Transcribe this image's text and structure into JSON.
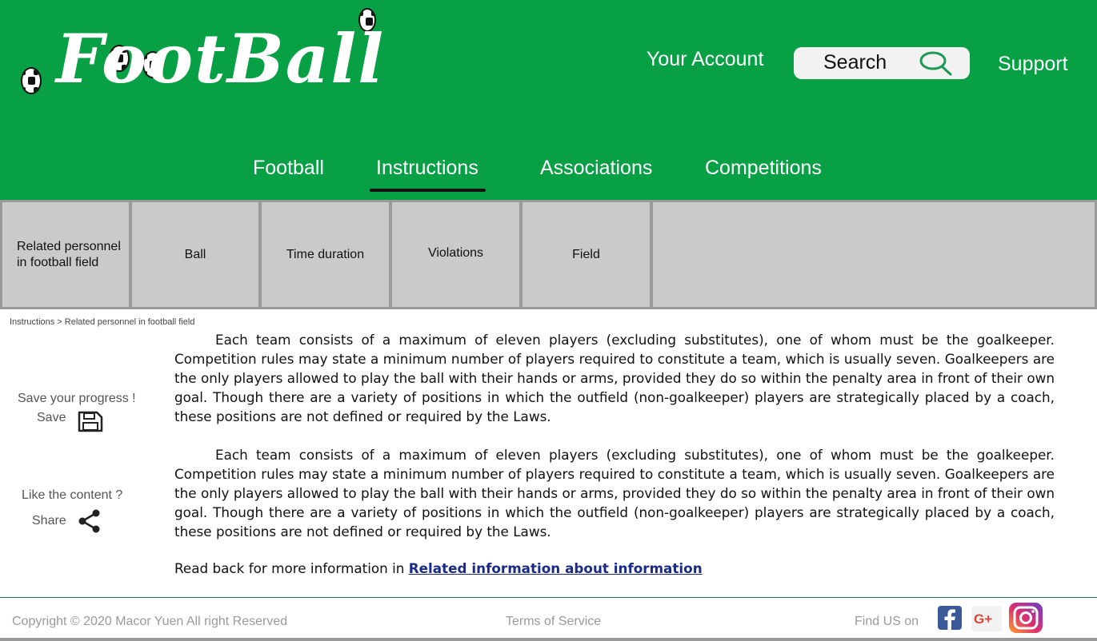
{
  "header": {
    "logo_text": "FootBall",
    "account_label": "Your Account",
    "search_label": "Search",
    "support_label": "Support"
  },
  "nav": {
    "tabs": [
      {
        "label": "Football"
      },
      {
        "label": "Instructions",
        "active": true
      },
      {
        "label": "Associations"
      },
      {
        "label": "Competitions"
      }
    ]
  },
  "subtabs": [
    {
      "label": "Related personnel in football field"
    },
    {
      "label": "Ball"
    },
    {
      "label": "Time duration"
    },
    {
      "label": "Violations"
    },
    {
      "label": "Field"
    }
  ],
  "breadcrumb": "Instructions > Related personnel in football field",
  "sidebar": {
    "save_prompt": "Save your progress !",
    "save_label": "Save",
    "share_prompt": "Like the content ?",
    "share_label": "Share"
  },
  "content": {
    "paragraphs": [
      "Each team consists of a maximum of eleven players (excluding substitutes), one of whom must be the goalkeeper. Competition rules may state a minimum number of players required to constitute a team, which is usually seven. Goalkeepers are the only players allowed to play the ball with their hands or arms, provided they do so within the penalty area in front of their own goal. Though there are a variety of positions in which the outfield (non-goalkeeper) players are strategically placed by a coach, these positions are not defined or required by the Laws.",
      "Each team consists of a maximum of eleven players (excluding substitutes), one of whom must be the goalkeeper. Competition rules may state a minimum number of players required to constitute a team, which is usually seven. Goalkeepers are the only players allowed to play the ball with their hands or arms, provided they do so within the penalty area in front of their own goal. Though there are a variety of positions in which the outfield (non-goalkeeper) players are strategically placed by a coach, these positions are not defined or required by the Laws."
    ],
    "readback_prefix": "Read back for more information in ",
    "readback_link": "Related information about information"
  },
  "footer": {
    "copyright": "Copyright © 2020 Macor Yuen All right Reserved",
    "terms": "Terms of Service",
    "find_us": "Find US on",
    "social": [
      "facebook-icon",
      "google-plus-icon",
      "instagram-icon"
    ]
  },
  "colors": {
    "header_green": "#08a045",
    "subtab_grey": "#cacaca",
    "link_blue": "#1a2a8a",
    "footer_text": "#9a9a9a"
  }
}
